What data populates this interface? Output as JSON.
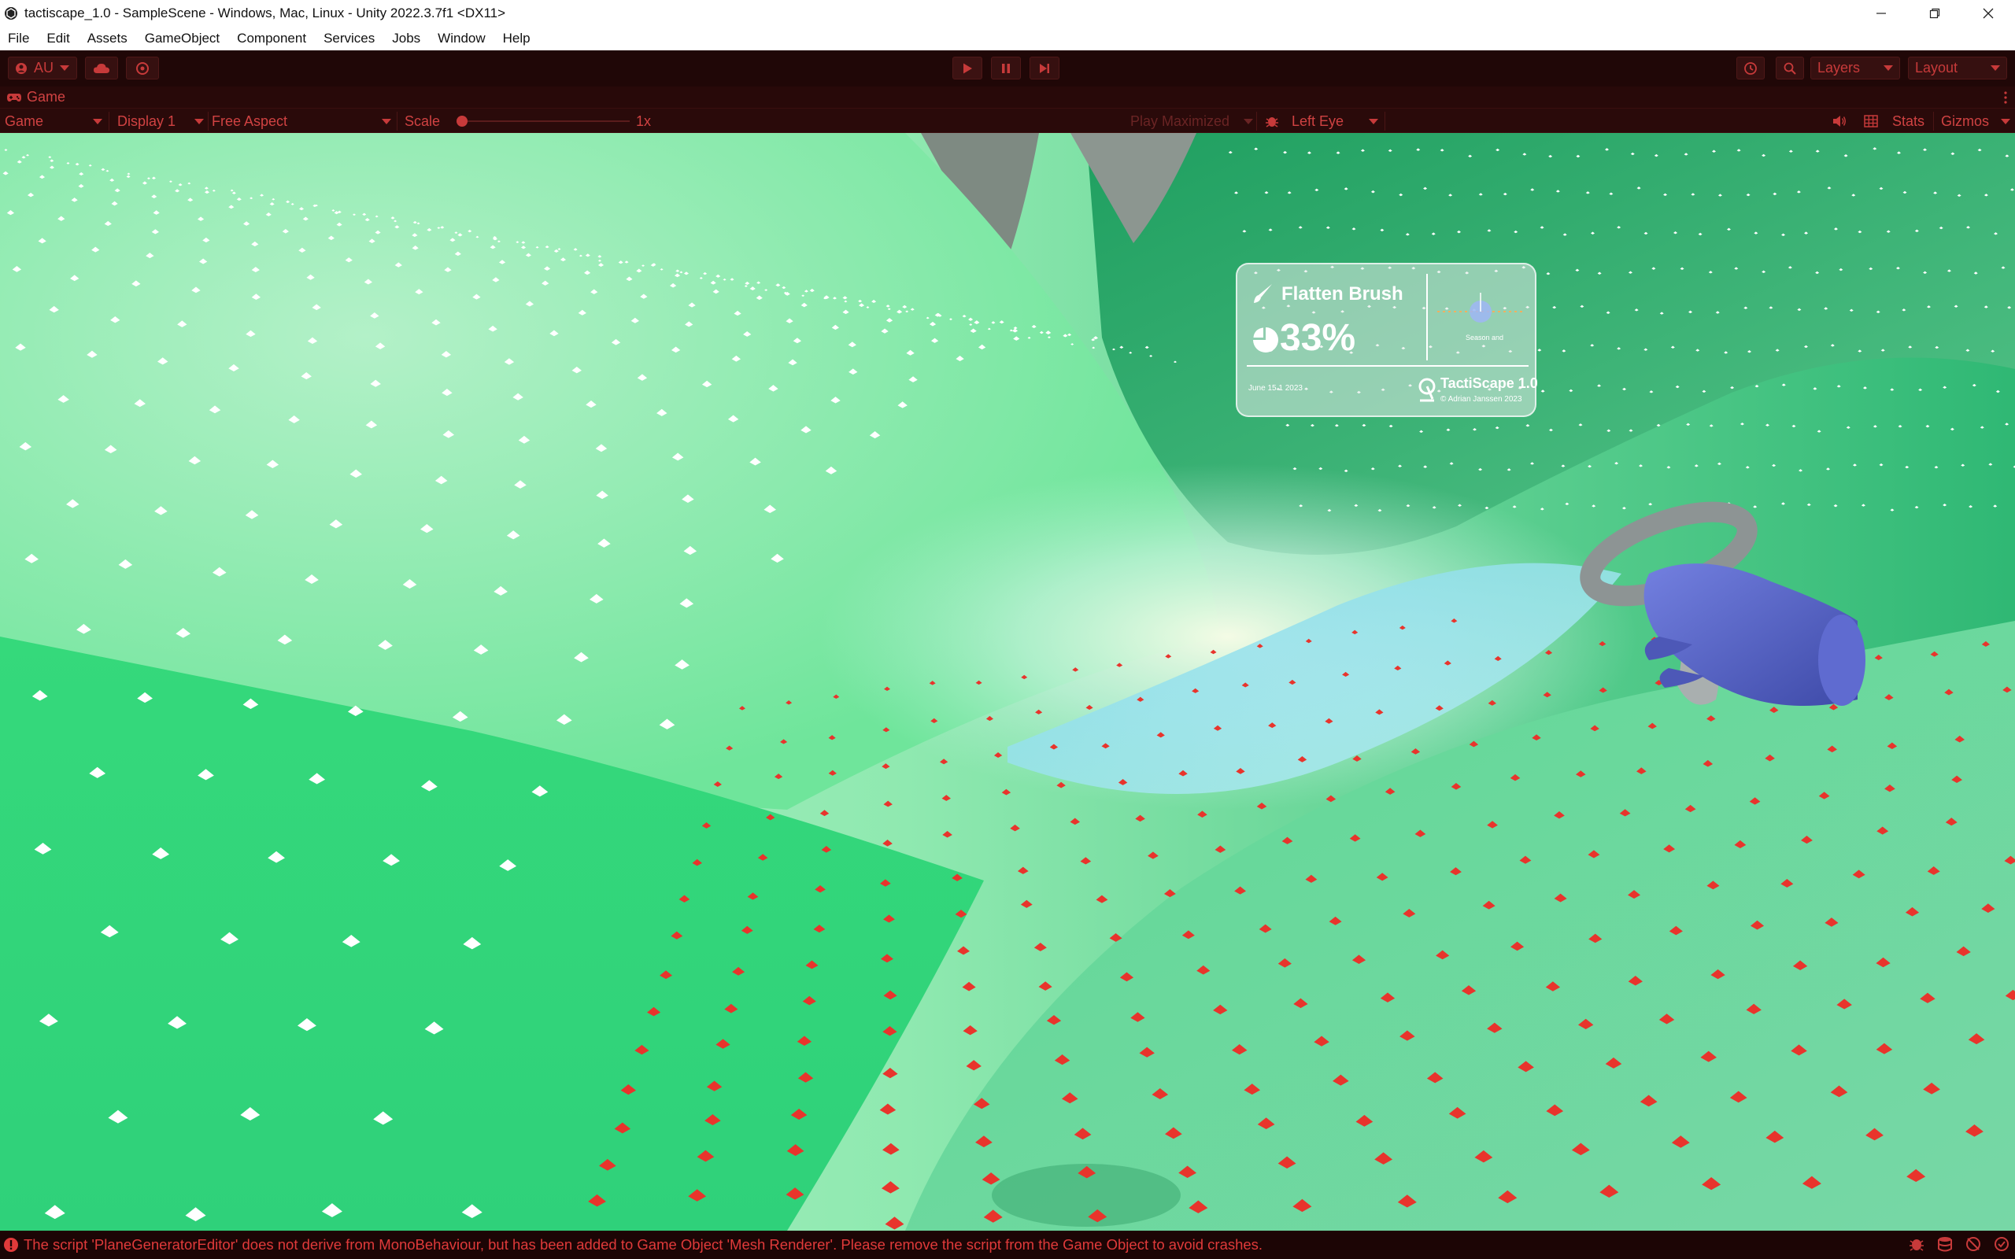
{
  "window": {
    "title": "tactiscape_1.0 - SampleScene - Windows, Mac, Linux - Unity 2022.3.7f1 <DX11>"
  },
  "menu": [
    "File",
    "Edit",
    "Assets",
    "GameObject",
    "Component",
    "Services",
    "Jobs",
    "Window",
    "Help"
  ],
  "toolbar": {
    "account_label": "AU",
    "layers_label": "Layers",
    "layout_label": "Layout"
  },
  "game_tab": {
    "label": "Game"
  },
  "game_bar": {
    "view_select": "Game",
    "display_select": "Display 1",
    "aspect_select": "Free Aspect",
    "scale_label": "Scale",
    "scale_value": "1x",
    "scale_level": 0,
    "play_mode_select": "Play Maximized",
    "eye_select": "Left Eye",
    "stats_label": "Stats",
    "gizmos_label": "Gizmos"
  },
  "hud": {
    "tool_name": "Flatten Brush",
    "percent": "33%",
    "date_text": "June 15 1 2023",
    "brand": "TactiScape 1.0",
    "copyright": "© Adrian Janssen 2023",
    "mini_label": "Season and"
  },
  "status": {
    "message": "The script 'PlaneGeneratorEditor' does not derive from MonoBehaviour, but has been added to Game Object 'Mesh Renderer'. Please remove the script from the Game Object to avoid crashes."
  },
  "colors": {
    "toolbar_bg": "#200707",
    "accent_red": "#c73a3a",
    "terrain_green": "#2fd17a",
    "hand_blue": "#5a66c8"
  },
  "icons": {
    "app": "unity-logo-icon",
    "play": "play-icon",
    "pause": "pause-icon",
    "step": "step-icon",
    "history": "history-icon",
    "search": "search-icon",
    "cloud": "cloud-icon",
    "brush": "brush-icon"
  }
}
